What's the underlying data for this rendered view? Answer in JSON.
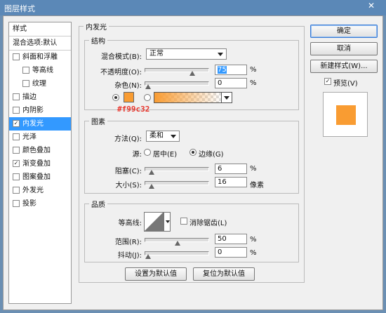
{
  "window": {
    "title": "图层样式",
    "close_glyph": "✕"
  },
  "styles_panel": {
    "header": "样式",
    "blend_options": "混合选项:默认",
    "items": [
      {
        "label": "斜面和浮雕",
        "checked": false,
        "sub": false
      },
      {
        "label": "等高线",
        "checked": false,
        "sub": true
      },
      {
        "label": "纹理",
        "checked": false,
        "sub": true
      },
      {
        "label": "描边",
        "checked": false,
        "sub": false
      },
      {
        "label": "内阴影",
        "checked": false,
        "sub": false
      },
      {
        "label": "内发光",
        "checked": true,
        "sub": false,
        "selected": true
      },
      {
        "label": "光泽",
        "checked": false,
        "sub": false
      },
      {
        "label": "颜色叠加",
        "checked": false,
        "sub": false
      },
      {
        "label": "渐变叠加",
        "checked": true,
        "sub": false
      },
      {
        "label": "图案叠加",
        "checked": false,
        "sub": false
      },
      {
        "label": "外发光",
        "checked": false,
        "sub": false
      },
      {
        "label": "投影",
        "checked": false,
        "sub": false
      }
    ],
    "check_glyph": "✓"
  },
  "inner_glow": {
    "title": "内发光",
    "structure": {
      "title": "结构",
      "blend_mode_label": "混合模式(B):",
      "blend_mode_value": "正常",
      "opacity_label": "不透明度(O):",
      "opacity_value": "75",
      "opacity_level": 75,
      "noise_label": "杂色(N):",
      "noise_value": "0",
      "noise_level": 0,
      "percent": "%",
      "glow_color": "#f99c32",
      "hex_note": "#f99c32",
      "hex_note_color": "#e8332a"
    },
    "elements": {
      "title": "图素",
      "technique_label": "方法(Q):",
      "technique_value": "柔和",
      "source_label": "源:",
      "source_center": "居中(E)",
      "source_edge": "边缘(G)",
      "choke_label": "阻塞(C):",
      "choke_value": "6",
      "choke_level": 6,
      "size_label": "大小(S):",
      "size_value": "16",
      "size_unit": "像素",
      "percent": "%"
    },
    "quality": {
      "title": "品质",
      "contour_label": "等高线:",
      "anti_alias_label": "消除锯齿(L)",
      "range_label": "范围(R):",
      "range_value": "50",
      "range_level": 50,
      "jitter_label": "抖动(J):",
      "jitter_value": "0",
      "jitter_level": 0,
      "percent": "%"
    },
    "buttons": {
      "set_default": "设置为默认值",
      "reset_default": "复位为默认值"
    }
  },
  "actions": {
    "ok": "确定",
    "cancel": "取消",
    "new_style": "新建样式(W)...",
    "preview_label": "预览(V)",
    "preview_checked": true
  },
  "colors": {
    "accent": "#3399ff",
    "title_bar": "#5b88b7",
    "glow": "#f99c32"
  }
}
